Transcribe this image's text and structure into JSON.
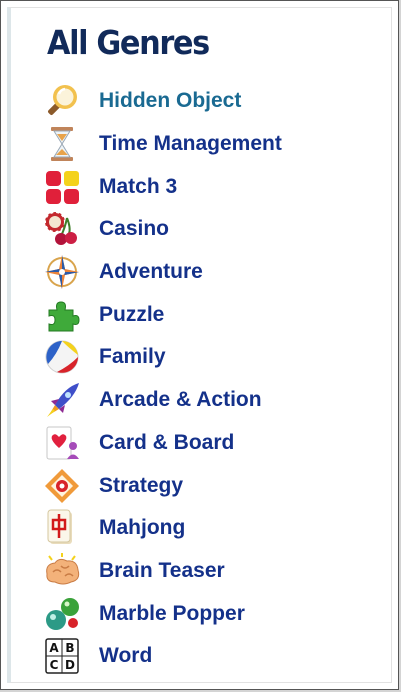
{
  "panel": {
    "title": "All Genres"
  },
  "genres": [
    {
      "label": "Hidden Object",
      "icon": "magnifier-icon",
      "active": true
    },
    {
      "label": "Time Management",
      "icon": "hourglass-icon"
    },
    {
      "label": "Match 3",
      "icon": "match3-tiles-icon"
    },
    {
      "label": "Casino",
      "icon": "casino-chips-cherries-icon"
    },
    {
      "label": "Adventure",
      "icon": "compass-icon"
    },
    {
      "label": "Puzzle",
      "icon": "puzzle-piece-icon"
    },
    {
      "label": "Family",
      "icon": "beach-ball-icon"
    },
    {
      "label": "Arcade & Action",
      "icon": "rocket-icon"
    },
    {
      "label": "Card & Board",
      "icon": "card-board-icon"
    },
    {
      "label": "Strategy",
      "icon": "strategy-target-icon"
    },
    {
      "label": "Mahjong",
      "icon": "mahjong-tile-icon"
    },
    {
      "label": "Brain Teaser",
      "icon": "brain-icon"
    },
    {
      "label": "Marble Popper",
      "icon": "marbles-icon"
    },
    {
      "label": "Word",
      "icon": "letter-tiles-icon"
    }
  ],
  "colors": {
    "title": "#112a5a",
    "link": "#14318a",
    "active_link": "#1a6a92"
  }
}
